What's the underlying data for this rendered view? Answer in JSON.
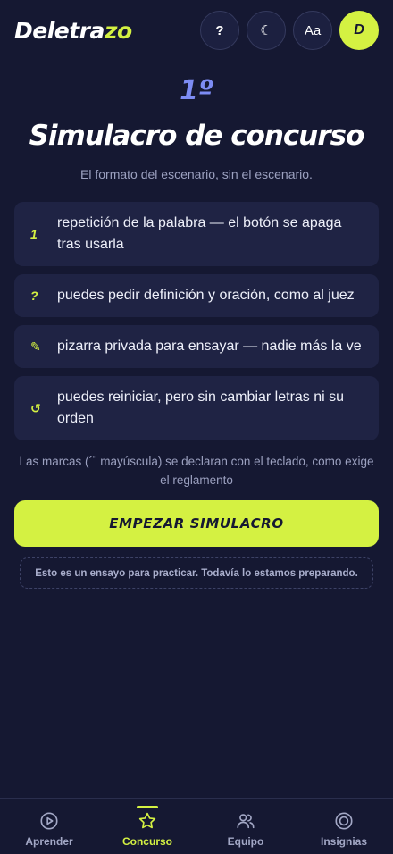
{
  "app": {
    "logo_main": "Deletra",
    "logo_accent": "zo",
    "help_label": "?",
    "theme_icon": "crescent-moon-icon",
    "theme_glyph": "☾",
    "font_size_label": "Aa",
    "avatar_initial": "D"
  },
  "main": {
    "round_number": "1º",
    "title": "Simulacro de concurso",
    "subtitle": "El formato del escenario, sin el escenario.",
    "rules": [
      {
        "icon": "number-one-icon",
        "glyph": "1",
        "text": "repetición de la palabra — el botón se apaga tras usarla"
      },
      {
        "icon": "question-mark-icon",
        "glyph": "?",
        "text": "puedes pedir definición y oración, como al juez"
      },
      {
        "icon": "pencil-icon",
        "glyph": "✎",
        "text": "pizarra privada para ensayar — nadie más la ve"
      },
      {
        "icon": "restart-icon",
        "glyph": "↺",
        "text": "puedes reiniciar, pero sin cambiar letras ni su orden"
      }
    ],
    "note": "Las marcas (´¨ mayúscula) se declaran con el teclado, como exige el reglamento",
    "start_button": "EMPEZAR SIMULACRO",
    "disclaimer": "Esto es un ensayo para practicar. Todavía lo estamos preparando."
  },
  "nav": {
    "items": [
      {
        "label": "Aprender",
        "icon": "play-circle-icon",
        "active": false
      },
      {
        "label": "Concurso",
        "icon": "star-icon",
        "active": true
      },
      {
        "label": "Equipo",
        "icon": "users-icon",
        "active": false
      },
      {
        "label": "Insignias",
        "icon": "badge-icon",
        "active": false
      }
    ]
  },
  "colors": {
    "background": "#151832",
    "card": "#1f2344",
    "accent": "#d4f142",
    "round_number": "#7d8cf4",
    "muted_text": "#9ca1c0"
  }
}
